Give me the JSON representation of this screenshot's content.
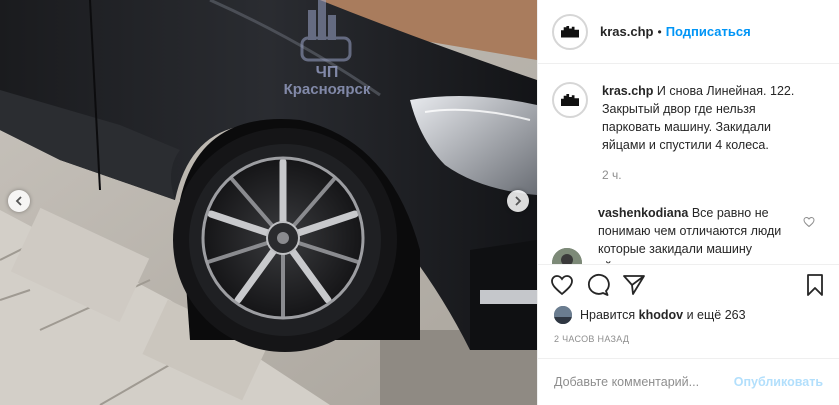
{
  "post": {
    "username": "kras.chp",
    "follow_label": "Подписаться",
    "dot": "•",
    "avatar_text": "ЧП Красноярск",
    "watermark_line1": "ЧП",
    "watermark_line2": "Красноярск",
    "caption": "И снова Линейная. 122. Закрытый двор где нельзя парковать машину. Закидали яйцами и спустили 4 колеса.",
    "time": "2 ч."
  },
  "comments": [
    {
      "username": "vashenkodiana",
      "text": "Все равно не понимаю чем отличаются люди которые закидали машину яйцами от того кто ее"
    }
  ],
  "actions": {
    "like_icon": "heart-icon",
    "comment_icon": "comment-icon",
    "share_icon": "share-icon",
    "save_icon": "bookmark-icon"
  },
  "likes": {
    "prefix": "Нравится",
    "user": "khodov",
    "suffix": "и ещё 263"
  },
  "ago": "2 ЧАСОВ НАЗАД",
  "comment_box": {
    "placeholder": "Добавьте комментарий...",
    "publish_label": "Опубликовать"
  },
  "colors": {
    "accent": "#0095f6",
    "publish_disabled": "#b2dffc",
    "muted": "#8e8e8e"
  }
}
